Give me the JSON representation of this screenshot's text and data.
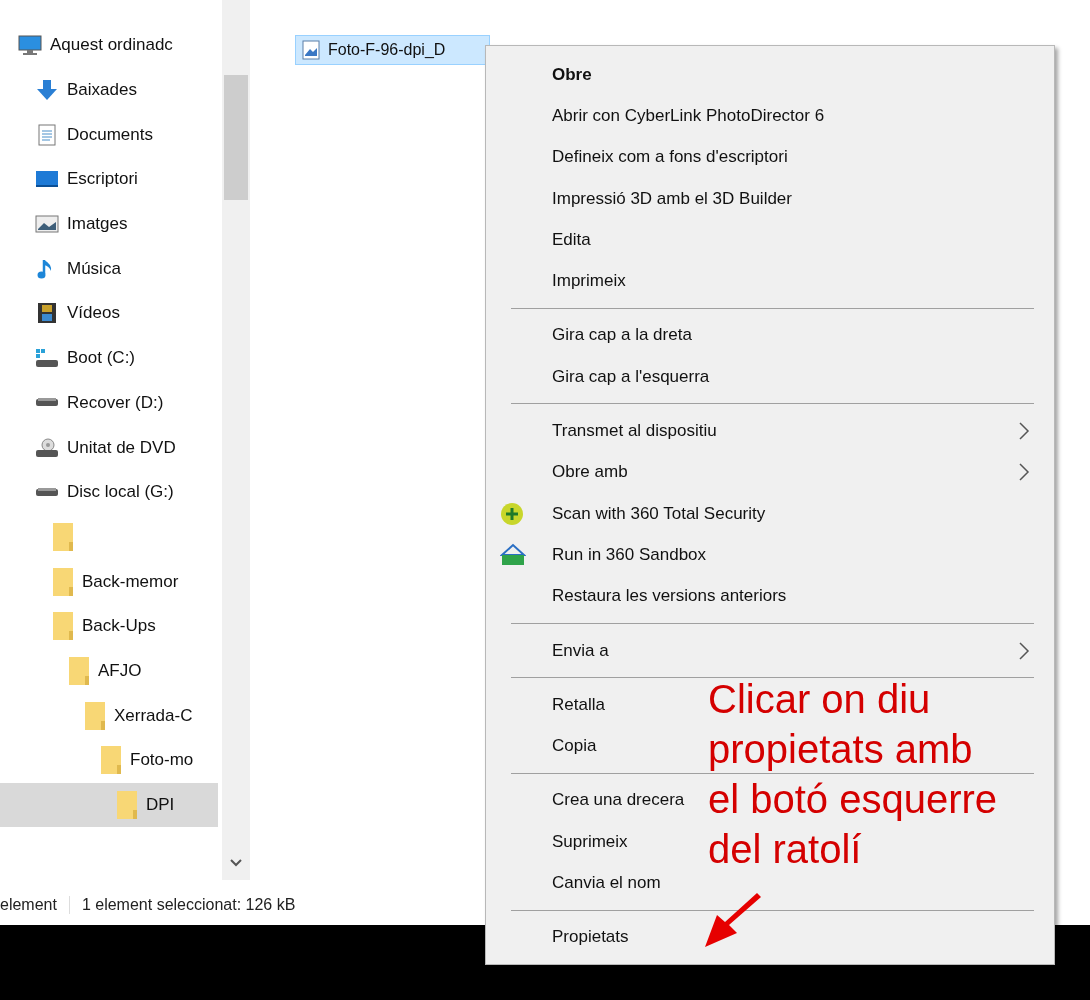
{
  "sidebar": {
    "items": [
      {
        "label": "Aquest ordinadc",
        "kind": "computer",
        "selected": false,
        "children": [
          {
            "label": "Baixades",
            "kind": "download",
            "selected": false
          },
          {
            "label": "Documents",
            "kind": "document",
            "selected": false
          },
          {
            "label": "Escriptori",
            "kind": "desktop",
            "selected": false
          },
          {
            "label": "Imatges",
            "kind": "pictures",
            "selected": false
          },
          {
            "label": "Música",
            "kind": "music",
            "selected": false
          },
          {
            "label": "Vídeos",
            "kind": "videos",
            "selected": false
          },
          {
            "label": "Boot (C:)",
            "kind": "system-drive",
            "selected": false
          },
          {
            "label": "Recover (D:)",
            "kind": "drive",
            "selected": false
          },
          {
            "label": "Unitat de DVD",
            "kind": "dvd",
            "selected": false
          },
          {
            "label": "Disc local (G:)",
            "kind": "drive",
            "selected": false,
            "children": [
              {
                "kind": "folder",
                "selected": false
              },
              {
                "label": "Back-memor",
                "kind": "folder",
                "selected": false
              },
              {
                "label": "Back-Ups",
                "kind": "folder",
                "selected": false,
                "children": [
                  {
                    "label": "AFJO",
                    "kind": "folder",
                    "selected": false,
                    "children": [
                      {
                        "label": "Xerrada-C",
                        "kind": "folder",
                        "selected": false,
                        "children": [
                          {
                            "label": "Foto-mo",
                            "kind": "folder",
                            "selected": false,
                            "children": [
                              {
                                "label": "DPI",
                                "kind": "folder",
                                "selected": true
                              }
                            ]
                          }
                        ]
                      }
                    ]
                  }
                ]
              }
            ]
          }
        ]
      }
    ]
  },
  "files": [
    {
      "name": "Foto-F-96-dpi_D",
      "selected": true
    }
  ],
  "status_bar": {
    "count": "element",
    "selection": "1 element seleccionat: 126 kB"
  },
  "context_menu": {
    "groups": [
      [
        {
          "label": "Obre",
          "kind": "plain",
          "default": true
        },
        {
          "label": "Abrir con CyberLink PhotoDirector 6",
          "kind": "plain",
          "default": false
        },
        {
          "label": "Defineix com a fons d'escriptori",
          "kind": "plain",
          "default": false
        },
        {
          "label": "Impressió 3D amb el 3D Builder",
          "kind": "plain",
          "default": false
        },
        {
          "label": "Edita",
          "kind": "plain",
          "default": false
        },
        {
          "label": "Imprimeix",
          "kind": "plain",
          "default": false
        }
      ],
      [
        {
          "label": "Gira cap a la dreta",
          "kind": "plain",
          "default": false
        },
        {
          "label": "Gira cap a l'esquerra",
          "kind": "plain",
          "default": false
        }
      ],
      [
        {
          "label": "Transmet al dispositiu",
          "kind": "submenu",
          "default": false
        },
        {
          "label": "Obre amb",
          "kind": "submenu",
          "default": false
        },
        {
          "label": "Scan with 360 Total Security",
          "kind": "scan-app",
          "default": false
        },
        {
          "label": "Run in 360 Sandbox",
          "kind": "sandbox-app",
          "default": false
        },
        {
          "label": "Restaura les versions anteriors",
          "kind": "plain",
          "default": false
        }
      ],
      [
        {
          "label": "Envia a",
          "kind": "submenu",
          "default": false
        }
      ],
      [
        {
          "label": "Retalla",
          "kind": "plain",
          "default": false
        },
        {
          "label": "Copia",
          "kind": "plain",
          "default": false
        }
      ],
      [
        {
          "label": "Crea una drecera",
          "kind": "plain",
          "default": false
        },
        {
          "label": "Suprimeix",
          "kind": "plain",
          "default": false
        },
        {
          "label": "Canvia el nom",
          "kind": "plain",
          "default": false
        }
      ],
      [
        {
          "label": "Propietats",
          "kind": "plain",
          "default": false
        }
      ]
    ]
  },
  "annotation": {
    "text": "Clicar on diu\npropietats amb\nel botó esquerre\ndel ratolí"
  }
}
